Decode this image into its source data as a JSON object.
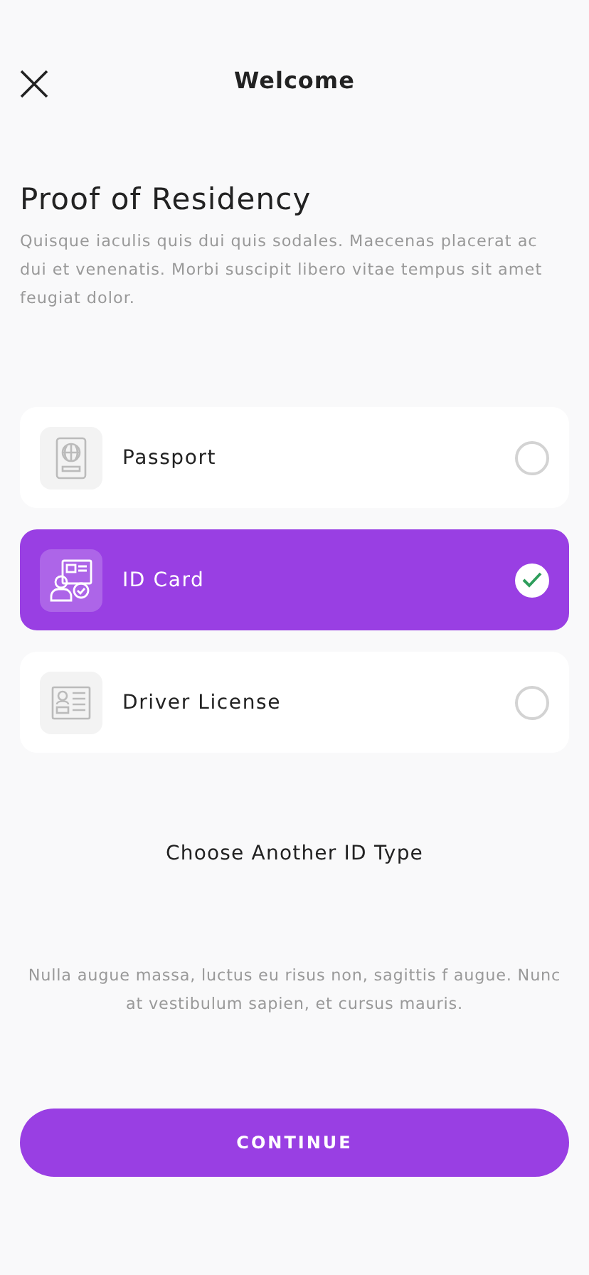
{
  "header": {
    "title": "Welcome"
  },
  "title": "Proof of Residency",
  "description": "Quisque iaculis quis dui quis sodales. Maecenas placerat ac dui et venenatis. Morbi suscipit libero vitae tempus sit amet feugiat dolor.",
  "options": [
    {
      "label": "Passport",
      "kind": "passport",
      "selected": false
    },
    {
      "label": "ID Card",
      "kind": "id_card",
      "selected": true
    },
    {
      "label": "Driver License",
      "kind": "license",
      "selected": false
    }
  ],
  "another_link": "Choose Another ID Type",
  "footer_note": "Nulla augue massa, luctus eu risus non, sagittis f augue. Nunc at vestibulum sapien, et cursus mauris.",
  "button": "CONTINUE"
}
